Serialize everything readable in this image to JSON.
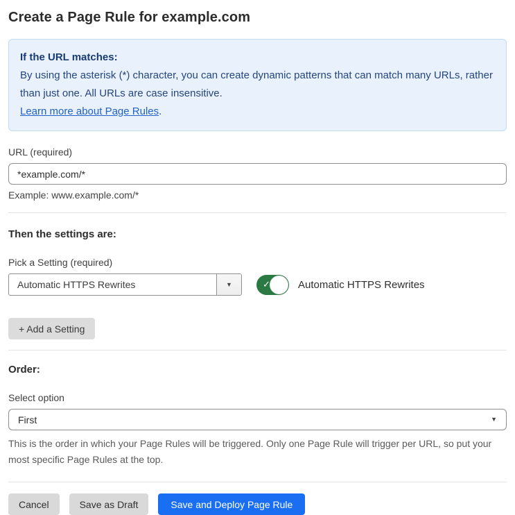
{
  "page": {
    "title": "Create a Page Rule for example.com"
  },
  "info_box": {
    "heading": "If the URL matches:",
    "body": "By using the asterisk (*) character, you can create dynamic patterns that can match many URLs, rather than just one. All URLs are case insensitive.",
    "link_text": "Learn more about Page Rules",
    "link_suffix": "."
  },
  "url_field": {
    "label": "URL (required)",
    "value": "*example.com/*",
    "hint": "Example: www.example.com/*"
  },
  "settings_section": {
    "heading": "Then the settings are:",
    "setting_label": "Pick a Setting (required)",
    "setting_value": "Automatic HTTPS Rewrites",
    "toggle_state": "on",
    "toggle_label": "Automatic HTTPS Rewrites",
    "add_setting_label": "+ Add a Setting"
  },
  "order_section": {
    "heading": "Order:",
    "select_label": "Select option",
    "select_value": "First",
    "help_text": "This is the order in which your Page Rules will be triggered. Only one Page Rule will trigger per URL, so put your most specific Page Rules at the top."
  },
  "footer": {
    "cancel_label": "Cancel",
    "save_draft_label": "Save as Draft",
    "deploy_label": "Save and Deploy Page Rule"
  },
  "colors": {
    "primary_blue": "#1a6ef2",
    "toggle_green": "#2b7a43",
    "info_background": "#e9f2fc",
    "info_border": "#c2dbf3",
    "info_text": "#24457e",
    "link_blue": "#2261c9"
  }
}
